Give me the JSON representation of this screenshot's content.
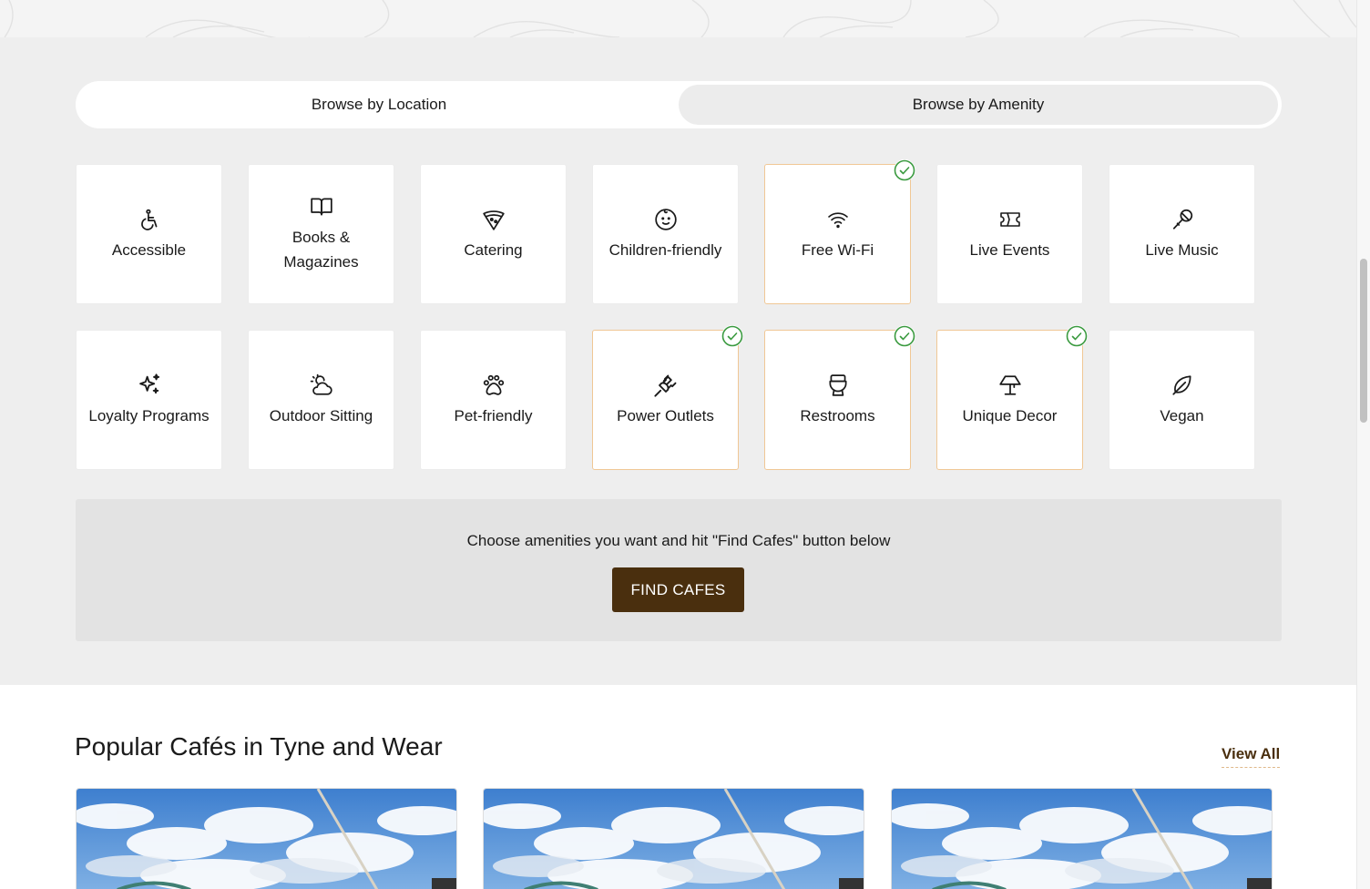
{
  "tabs": {
    "location": "Browse by Location",
    "amenity": "Browse by Amenity",
    "active": "amenity"
  },
  "amenities": [
    {
      "label": "Accessible",
      "icon": "wheelchair-icon",
      "selected": false
    },
    {
      "label": "Books & Magazines",
      "icon": "book-icon",
      "selected": false
    },
    {
      "label": "Catering",
      "icon": "pizza-slice-icon",
      "selected": false
    },
    {
      "label": "Children-friendly",
      "icon": "baby-face-icon",
      "selected": false
    },
    {
      "label": "Free Wi-Fi",
      "icon": "wifi-icon",
      "selected": true
    },
    {
      "label": "Live Events",
      "icon": "ticket-icon",
      "selected": false
    },
    {
      "label": "Live Music",
      "icon": "microphone-icon",
      "selected": false
    },
    {
      "label": "Loyalty Programs",
      "icon": "sparkles-icon",
      "selected": false
    },
    {
      "label": "Outdoor Sitting",
      "icon": "sun-cloud-icon",
      "selected": false
    },
    {
      "label": "Pet-friendly",
      "icon": "paw-icon",
      "selected": false
    },
    {
      "label": "Power Outlets",
      "icon": "plug-icon",
      "selected": true
    },
    {
      "label": "Restrooms",
      "icon": "toilet-icon",
      "selected": true
    },
    {
      "label": "Unique Decor",
      "icon": "lamp-icon",
      "selected": true
    },
    {
      "label": "Vegan",
      "icon": "leaf-icon",
      "selected": false
    }
  ],
  "cta": {
    "text": "Choose amenities you want and hit \"Find Cafes\" button below",
    "button": "FIND CAFES"
  },
  "popular": {
    "title": "Popular Cafés in Tyne and Wear",
    "view_all": "View All",
    "cards": [
      {
        "image": "tyne-bridge-photo"
      },
      {
        "image": "tyne-bridge-photo"
      },
      {
        "image": "tyne-bridge-photo"
      }
    ]
  },
  "colors": {
    "brand": "#4a2f0e",
    "selected_border": "#f0c795",
    "check_green": "#3a9a3f",
    "section_bg": "#eeeeee"
  }
}
